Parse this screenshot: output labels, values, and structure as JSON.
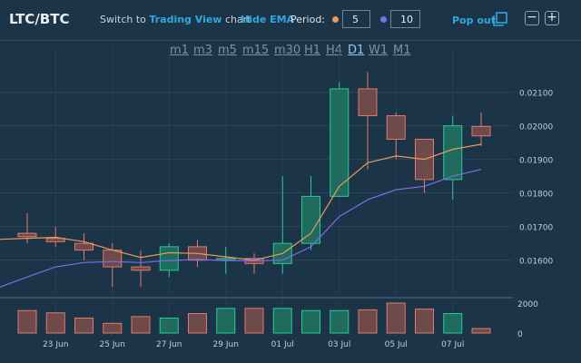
{
  "header": {
    "pair": "LTC/BTC",
    "switch_text": "Switch to",
    "switch_link": "Trading View",
    "switch_suffix": "chart",
    "hide_ema": "Hide EMA",
    "period_label": "Period:",
    "period_fast": "5",
    "period_slow": "10",
    "popout": "Pop out",
    "minimize": "−",
    "maximize": "+"
  },
  "timeframes": [
    "m1",
    "m3",
    "m5",
    "m15",
    "m30",
    "H1",
    "H4",
    "D1",
    "W1",
    "M1"
  ],
  "active_timeframe": "D1",
  "colors": {
    "background": "#1b3447",
    "up": "#2ec79a",
    "down": "#e07a6b",
    "ema_fast": "#e89a5a",
    "ema_slow": "#7a6ee6",
    "accent": "#2fa8e0"
  },
  "chart_data": {
    "type": "candlestick",
    "x_labels": [
      "23 Jun",
      "25 Jun",
      "27 Jun",
      "29 Jun",
      "01 Jul",
      "03 Jul",
      "05 Jul",
      "07 Jul"
    ],
    "price_ticks": [
      "0.02100",
      "0.02000",
      "0.01900",
      "0.01800",
      "0.01700",
      "0.01600"
    ],
    "volume_ticks": [
      "2000",
      "0"
    ],
    "ylim": [
      0.0151,
      0.0218
    ],
    "volume_ylim": [
      0,
      2000
    ],
    "candles": [
      {
        "date": "22 Jun",
        "o": 0.0168,
        "h": 0.0174,
        "l": 0.0165,
        "c": 0.0167,
        "v": 1500
      },
      {
        "date": "23 Jun",
        "o": 0.01665,
        "h": 0.017,
        "l": 0.0164,
        "c": 0.01655,
        "v": 1350
      },
      {
        "date": "24 Jun",
        "o": 0.0165,
        "h": 0.0168,
        "l": 0.016,
        "c": 0.0163,
        "v": 1000
      },
      {
        "date": "25 Jun",
        "o": 0.0163,
        "h": 0.0165,
        "l": 0.0152,
        "c": 0.0158,
        "v": 650
      },
      {
        "date": "26 Jun",
        "o": 0.0158,
        "h": 0.0163,
        "l": 0.0152,
        "c": 0.0157,
        "v": 1100
      },
      {
        "date": "27 Jun",
        "o": 0.0157,
        "h": 0.0165,
        "l": 0.0155,
        "c": 0.0164,
        "v": 1000
      },
      {
        "date": "28 Jun",
        "o": 0.0164,
        "h": 0.0166,
        "l": 0.0158,
        "c": 0.016,
        "v": 1300
      },
      {
        "date": "29 Jun",
        "o": 0.016,
        "h": 0.0164,
        "l": 0.0156,
        "c": 0.01605,
        "v": 1650
      },
      {
        "date": "30 Jun",
        "o": 0.01605,
        "h": 0.0162,
        "l": 0.0156,
        "c": 0.0159,
        "v": 1650
      },
      {
        "date": "01 Jul",
        "o": 0.0159,
        "h": 0.0185,
        "l": 0.0156,
        "c": 0.0165,
        "v": 1650
      },
      {
        "date": "02 Jul",
        "o": 0.0165,
        "h": 0.0185,
        "l": 0.0163,
        "c": 0.0179,
        "v": 1500
      },
      {
        "date": "03 Jul",
        "o": 0.0179,
        "h": 0.0213,
        "l": 0.0179,
        "c": 0.0211,
        "v": 1500
      },
      {
        "date": "04 Jul",
        "o": 0.0211,
        "h": 0.0216,
        "l": 0.0187,
        "c": 0.0203,
        "v": 1550
      },
      {
        "date": "05 Jul",
        "o": 0.0203,
        "h": 0.0204,
        "l": 0.019,
        "c": 0.0196,
        "v": 2000
      },
      {
        "date": "06 Jul",
        "o": 0.0196,
        "h": 0.0196,
        "l": 0.018,
        "c": 0.0184,
        "v": 1600
      },
      {
        "date": "07 Jul",
        "o": 0.0184,
        "h": 0.0203,
        "l": 0.0178,
        "c": 0.02,
        "v": 1300
      },
      {
        "date": "08 Jul",
        "o": 0.01998,
        "h": 0.0204,
        "l": 0.0194,
        "c": 0.0197,
        "v": 300
      }
    ],
    "ema_fast": [
      0.01665,
      0.01668,
      0.01655,
      0.0163,
      0.01608,
      0.01622,
      0.0162,
      0.0161,
      0.016,
      0.0162,
      0.0168,
      0.0182,
      0.0189,
      0.0191,
      0.019,
      0.0193,
      0.01945
    ],
    "ema_slow": [
      0.0155,
      0.0158,
      0.01593,
      0.01596,
      0.01593,
      0.01599,
      0.01602,
      0.01599,
      0.01598,
      0.016,
      0.0164,
      0.0173,
      0.0178,
      0.0181,
      0.0182,
      0.0185,
      0.0187
    ]
  }
}
